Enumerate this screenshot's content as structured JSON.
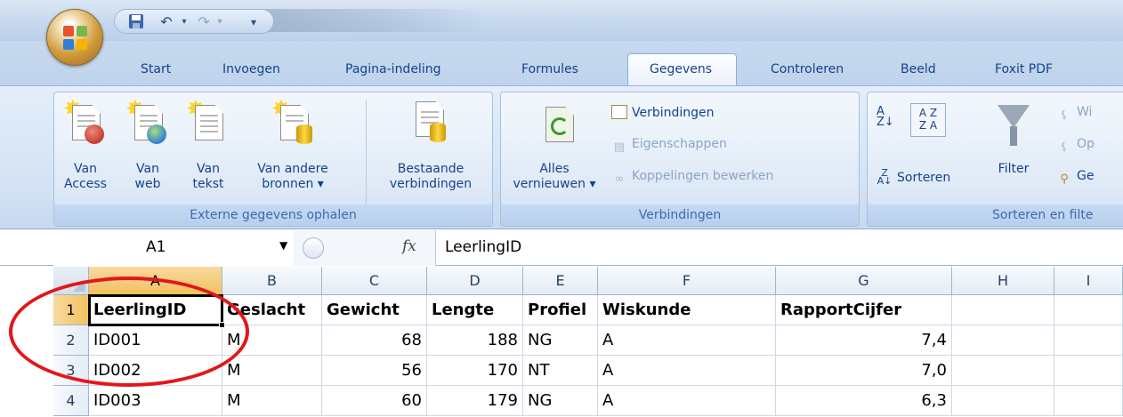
{
  "qat": {
    "save_icon": "save-icon",
    "undo_icon": "undo-icon",
    "redo_icon": "redo-icon"
  },
  "tabs": [
    {
      "label": "Start"
    },
    {
      "label": "Invoegen"
    },
    {
      "label": "Pagina-indeling"
    },
    {
      "label": "Formules"
    },
    {
      "label": "Gegevens",
      "active": true
    },
    {
      "label": "Controleren"
    },
    {
      "label": "Beeld"
    },
    {
      "label": "Foxit PDF"
    }
  ],
  "ribbon": {
    "external": {
      "label": "Externe gegevens ophalen",
      "access": [
        "Van",
        "Access"
      ],
      "web": [
        "Van",
        "web"
      ],
      "text": [
        "Van",
        "tekst"
      ],
      "other": [
        "Van andere",
        "bronnen ▾"
      ],
      "existing": [
        "Bestaande",
        "verbindingen"
      ]
    },
    "connections": {
      "label": "Verbindingen",
      "refresh": [
        "Alles",
        "vernieuwen ▾"
      ],
      "connections": "Verbindingen",
      "properties": "Eigenschappen",
      "edit_links": "Koppelingen bewerken"
    },
    "sort": {
      "label": "Sorteren en filte",
      "sort": "Sorteren",
      "filter": "Filter",
      "clear": "Wi",
      "reapply": "Op",
      "advanced": "Ge"
    }
  },
  "formula_bar": {
    "name_box": "A1",
    "fx": "fx",
    "formula": "LeerlingID"
  },
  "sheet": {
    "columns": [
      "A",
      "B",
      "C",
      "D",
      "E",
      "F",
      "G",
      "H",
      "I"
    ],
    "rows": [
      {
        "n": "1",
        "cells": [
          "LeerlingID",
          "Geslacht",
          "Gewicht",
          "Lengte",
          "Profiel",
          "Wiskunde",
          "RapportCijfer",
          "",
          ""
        ]
      },
      {
        "n": "2",
        "cells": [
          "ID001",
          "M",
          "68",
          "188",
          "NG",
          "A",
          "7,4",
          "",
          ""
        ]
      },
      {
        "n": "3",
        "cells": [
          "ID002",
          "M",
          "56",
          "170",
          "NT",
          "A",
          "7,0",
          "",
          ""
        ]
      },
      {
        "n": "4",
        "cells": [
          "ID003",
          "M",
          "60",
          "179",
          "NG",
          "A",
          "6,3",
          "",
          ""
        ]
      }
    ]
  },
  "colors": {
    "annotation": "#e3161b",
    "selected_header": "#f1c15f"
  }
}
